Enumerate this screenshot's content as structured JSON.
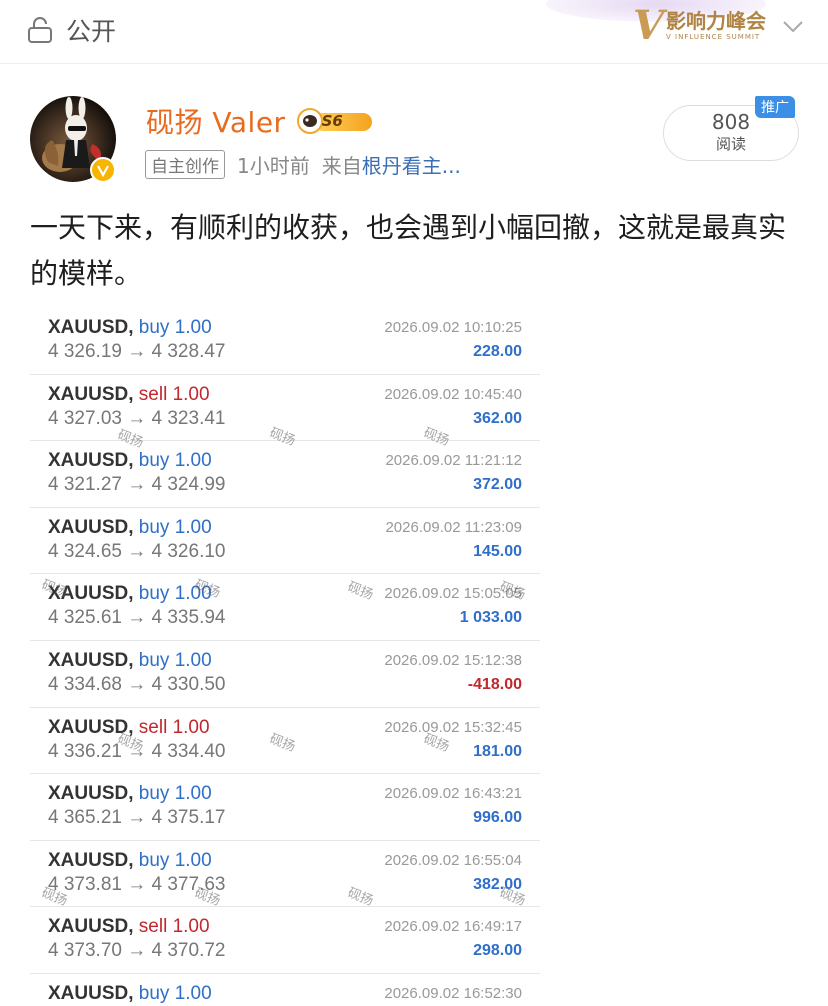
{
  "header": {
    "visibility_label": "公开",
    "visibility_icon": "lock-icon",
    "brand_name": "影响力峰会",
    "brand_sub": "V INFLUENCE SUMMIT",
    "menu_icon": "chevron-down-icon"
  },
  "author": {
    "name": "砚扬 Valer",
    "level_badge": "S6",
    "verified_icon": "verified-badge-icon",
    "tag": "自主创作",
    "time": "1小时前",
    "from_prefix": "来自",
    "source": "根丹看主..."
  },
  "reads": {
    "count": "808",
    "unit": "阅读",
    "promo": "推广"
  },
  "post": {
    "text": "一天下来，有顺利的收获，也会遇到小幅回撤，这就是最真实的模样。"
  },
  "watermark": "砚扬",
  "trades": [
    {
      "symbol": "XAUUSD,",
      "side": "buy",
      "lot": "1.00",
      "prices": "4 326.19 → 4 328.47",
      "time": "2026.09.02 10:10:25",
      "pnl": "228.00",
      "positive": true
    },
    {
      "symbol": "XAUUSD,",
      "side": "sell",
      "lot": "1.00",
      "prices": "4 327.03 → 4 323.41",
      "time": "2026.09.02 10:45:40",
      "pnl": "362.00",
      "positive": true
    },
    {
      "symbol": "XAUUSD,",
      "side": "buy",
      "lot": "1.00",
      "prices": "4 321.27 → 4 324.99",
      "time": "2026.09.02 11:21:12",
      "pnl": "372.00",
      "positive": true
    },
    {
      "symbol": "XAUUSD,",
      "side": "buy",
      "lot": "1.00",
      "prices": "4 324.65 → 4 326.10",
      "time": "2026.09.02 11:23:09",
      "pnl": "145.00",
      "positive": true
    },
    {
      "symbol": "XAUUSD,",
      "side": "buy",
      "lot": "1.00",
      "prices": "4 325.61 → 4 335.94",
      "time": "2026.09.02 15:05:05",
      "pnl": "1 033.00",
      "positive": true
    },
    {
      "symbol": "XAUUSD,",
      "side": "buy",
      "lot": "1.00",
      "prices": "4 334.68 → 4 330.50",
      "time": "2026.09.02 15:12:38",
      "pnl": "-418.00",
      "positive": false
    },
    {
      "symbol": "XAUUSD,",
      "side": "sell",
      "lot": "1.00",
      "prices": "4 336.21 → 4 334.40",
      "time": "2026.09.02 15:32:45",
      "pnl": "181.00",
      "positive": true
    },
    {
      "symbol": "XAUUSD,",
      "side": "buy",
      "lot": "1.00",
      "prices": "4 365.21 → 4 375.17",
      "time": "2026.09.02 16:43:21",
      "pnl": "996.00",
      "positive": true
    },
    {
      "symbol": "XAUUSD,",
      "side": "buy",
      "lot": "1.00",
      "prices": "4 373.81 → 4 377.63",
      "time": "2026.09.02 16:55:04",
      "pnl": "382.00",
      "positive": true
    },
    {
      "symbol": "XAUUSD,",
      "side": "sell",
      "lot": "1.00",
      "prices": "4 373.70 → 4 370.72",
      "time": "2026.09.02 16:49:17",
      "pnl": "298.00",
      "positive": true
    },
    {
      "symbol": "XAUUSD,",
      "side": "buy",
      "lot": "1.00",
      "prices": "",
      "time": "2026.09.02 16:52:30",
      "pnl": "",
      "positive": true
    }
  ]
}
